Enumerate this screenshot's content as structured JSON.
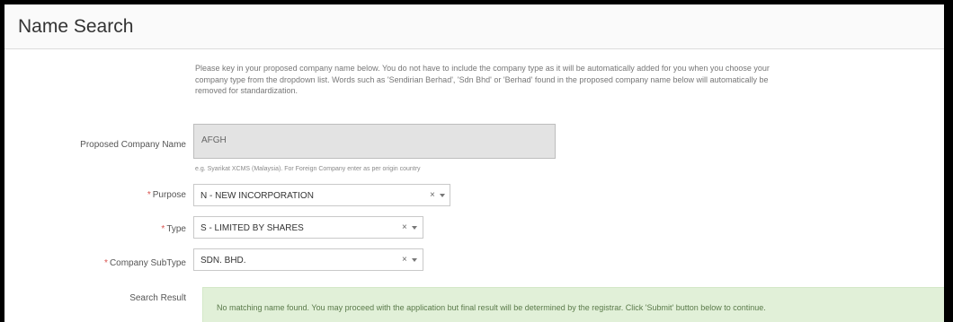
{
  "panel": {
    "title": "Name Search"
  },
  "intro_text": "Please key in your proposed company name below. You do not have to include the company type as it will be automatically added for you when you choose your company type from the dropdown list. Words such as 'Sendirian Berhad', 'Sdn Bhd' or 'Berhad' found in the proposed company name below will automatically be removed for standardization.",
  "form": {
    "company_name": {
      "label": "Proposed Company Name",
      "value": "AFGH",
      "hint": "e.g. Syarikat XCMS (Malaysia). For Foreign Company enter as per origin country"
    },
    "purpose": {
      "required_mark": "*",
      "label": "Purpose",
      "value": "N - NEW INCORPORATION"
    },
    "type": {
      "required_mark": "*",
      "label": "Type",
      "value": "S - LIMITED BY SHARES"
    },
    "subtype": {
      "required_mark": "*",
      "label": "Company SubType",
      "value": "SDN. BHD."
    },
    "clear_glyph": "×"
  },
  "search_result": {
    "label": "Search Result",
    "message": "No matching name found. You may proceed with the application but final result will be determined by the registrar. Click 'Submit' button below to continue."
  },
  "colors": {
    "required": "#d9534f",
    "result_bg": "#e1f0d8",
    "input_disabled_bg": "#e3e3e3"
  }
}
